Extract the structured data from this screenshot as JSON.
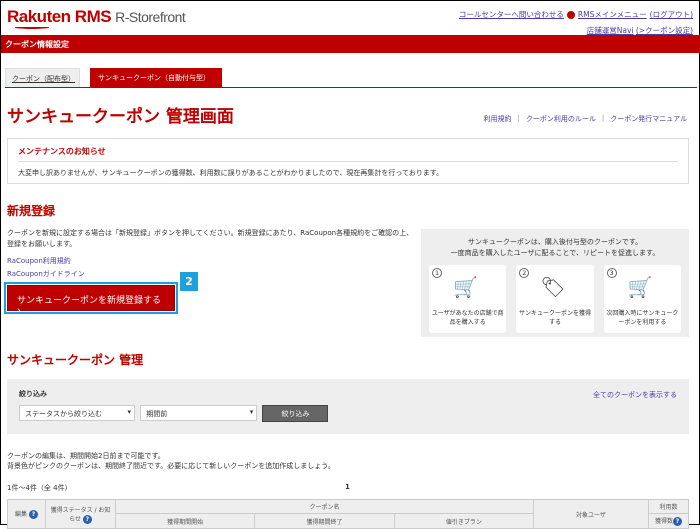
{
  "header": {
    "logo": "Rakuten RMS",
    "logo_sub": "R-Storefront",
    "call_center": "コールセンターへ問い合わせる",
    "rms_menu": "RMSメインメニュー",
    "logout": "(ログアウト)",
    "store_navi": "店舗運営Navi",
    "coupon_settings": "(>クーポン設定)"
  },
  "redbar": {
    "title": "クーポン情報設定"
  },
  "tabs": [
    {
      "label": "クーポン（配布型）"
    },
    {
      "label": "サンキュークーポン（自動付与型）"
    }
  ],
  "page": {
    "title": "サンキュークーポン 管理画面",
    "links": [
      "利用規約",
      "クーポン利用のルール",
      "クーポン発行マニュアル"
    ]
  },
  "notice": {
    "title": "メンテナンスのお知らせ",
    "text": "大変申し訳ありませんが、サンキュークーポンの獲得数、利用数に誤りがあることがわかりましたので、現在再集計を行っております。"
  },
  "register": {
    "heading": "新規登録",
    "desc": "クーポンを新規に設定する場合は「新規登録」ボタンを押してください。新規登録にあたり、RaCoupon各種規約をご確認の上、登録をお願いします。",
    "link1": "RaCoupon利用規約",
    "link2": "RaCouponガイドライン",
    "button": "サンキュークーポンを新規登録する",
    "badge": "2"
  },
  "info": {
    "line1": "サンキュークーポンは、購入後付与型のクーポンです。",
    "line2": "一度商品を購入したユーザに配ることで、リピートを促進します。",
    "steps": [
      {
        "num": "1",
        "text": "ユーザがあなたの店舗で商品を購入する"
      },
      {
        "num": "2",
        "text": "サンキュークーポンを獲得する"
      },
      {
        "num": "3",
        "text": "次回購入時にサンキュークーポンを利用する"
      }
    ]
  },
  "manage": {
    "heading": "サンキュークーポン 管理",
    "filter_label": "絞り込み",
    "show_all": "全てのクーポンを表示する",
    "status_select": "ステータスから絞り込む",
    "period_select": "期間前",
    "filter_button": "絞り込み",
    "note1": "クーポンの編集は、期間開始2日前まで可能です。",
    "note2": "背景色がピンクのクーポンは、期間終了間近です。必要に応じて新しいクーポンを追加作成しましょう。",
    "count": "1件～4件（全 4件）",
    "page": "1"
  },
  "table": {
    "edit": "編集",
    "status": "獲得ステータス / お知らせ",
    "coupon_name": "クーポン名",
    "start": "獲得期間開始",
    "end": "獲得期間終了",
    "plan": "値引きプラン",
    "target": "対象ユーザ",
    "used": "利用数",
    "acquired": "獲得数",
    "help": "?"
  }
}
